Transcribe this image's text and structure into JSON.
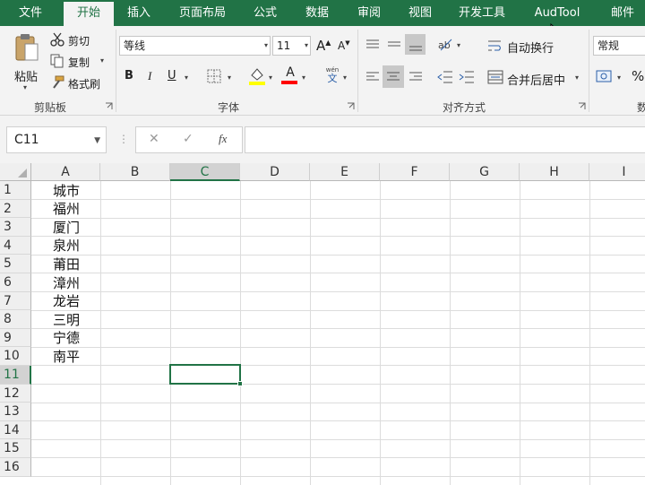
{
  "tabs": [
    "文件",
    "开始",
    "插入",
    "页面布局",
    "公式",
    "数据",
    "审阅",
    "视图",
    "开发工具",
    "AudTool",
    "邮件"
  ],
  "active_tab": "开始",
  "clipboard": {
    "paste": "粘贴",
    "cut": "剪切",
    "copy": "复制",
    "format_painter": "格式刷",
    "group_label": "剪贴板"
  },
  "font": {
    "name": "等线",
    "size": "11",
    "bold": "B",
    "italic": "I",
    "underline": "U",
    "grow": "A",
    "shrink": "A",
    "group_label": "字体",
    "phonetic_top": "wén",
    "phonetic_bottom": "文"
  },
  "alignment": {
    "wrap_text": "自动换行",
    "merge_center": "合并后居中",
    "group_label": "对齐方式"
  },
  "number": {
    "format": "常规",
    "percent": "%",
    "group_label_partial": "数"
  },
  "formula_bar": {
    "name_box": "C11",
    "cancel": "✕",
    "enter": "✓",
    "fx": "fx",
    "value": ""
  },
  "columns": [
    "A",
    "B",
    "C",
    "D",
    "E",
    "F",
    "G",
    "H",
    "I"
  ],
  "rows": [
    "1",
    "2",
    "3",
    "4",
    "5",
    "6",
    "7",
    "8",
    "9",
    "10",
    "11",
    "12",
    "13",
    "14",
    "15",
    "16"
  ],
  "selected_column": "C",
  "selected_row": "11",
  "column_a": [
    "城市",
    "福州",
    "厦门",
    "泉州",
    "莆田",
    "漳州",
    "龙岩",
    "三明",
    "宁德",
    "南平"
  ],
  "colors": {
    "accent": "#217346",
    "fill_yellow": "#ffff00",
    "font_red": "#ff0000"
  }
}
